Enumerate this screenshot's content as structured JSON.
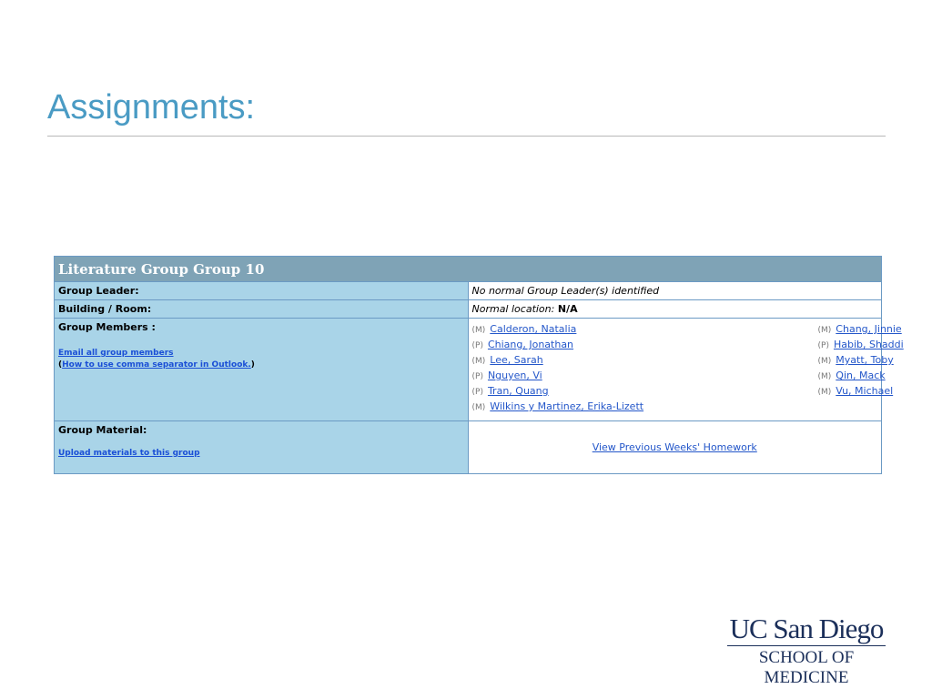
{
  "slide": {
    "title": "Assignments:"
  },
  "table": {
    "header": "Literature Group Group 10",
    "group_leader": {
      "label": "Group Leader:",
      "value": "No normal Group Leader(s) identified"
    },
    "building_room": {
      "label": "Building / Room:",
      "value_prefix": "Normal location:",
      "value": "N/A"
    },
    "group_members": {
      "label": "Group Members :",
      "email_link": "Email all group members",
      "paren_open": "(",
      "how_to_link": "How to use comma separator in Outlook.",
      "paren_close": ")",
      "left_column": [
        {
          "role": "(M)",
          "name": "Calderon, Natalia"
        },
        {
          "role": "(P)",
          "name": "Chiang, Jonathan"
        },
        {
          "role": "(M)",
          "name": "Lee, Sarah"
        },
        {
          "role": "(P)",
          "name": "Nguyen, Vi"
        },
        {
          "role": "(P)",
          "name": "Tran, Quang"
        },
        {
          "role": "(M)",
          "name": "Wilkins y Martinez, Erika-Lizett"
        }
      ],
      "right_column": [
        {
          "role": "(M)",
          "name": "Chang, Jinnie"
        },
        {
          "role": "(P)",
          "name": "Habib, Shaddi"
        },
        {
          "role": "(M)",
          "name": "Myatt, Toby"
        },
        {
          "role": "(M)",
          "name": "Qin, Mack"
        },
        {
          "role": "(M)",
          "name": "Vu, Michael"
        }
      ]
    },
    "group_material": {
      "label": "Group Material:",
      "upload_link": "Upload materials to this group",
      "homework_link": "View Previous Weeks' Homework"
    }
  },
  "logo": {
    "line1": "UC San Diego",
    "line2": "SCHOOL OF MEDICINE"
  },
  "colors": {
    "title": "#4a9bc4",
    "table_header_bg": "#7fa3b6",
    "label_bg": "#a9d4e8",
    "link": "#2356c9",
    "logo": "#1b2f5a"
  }
}
